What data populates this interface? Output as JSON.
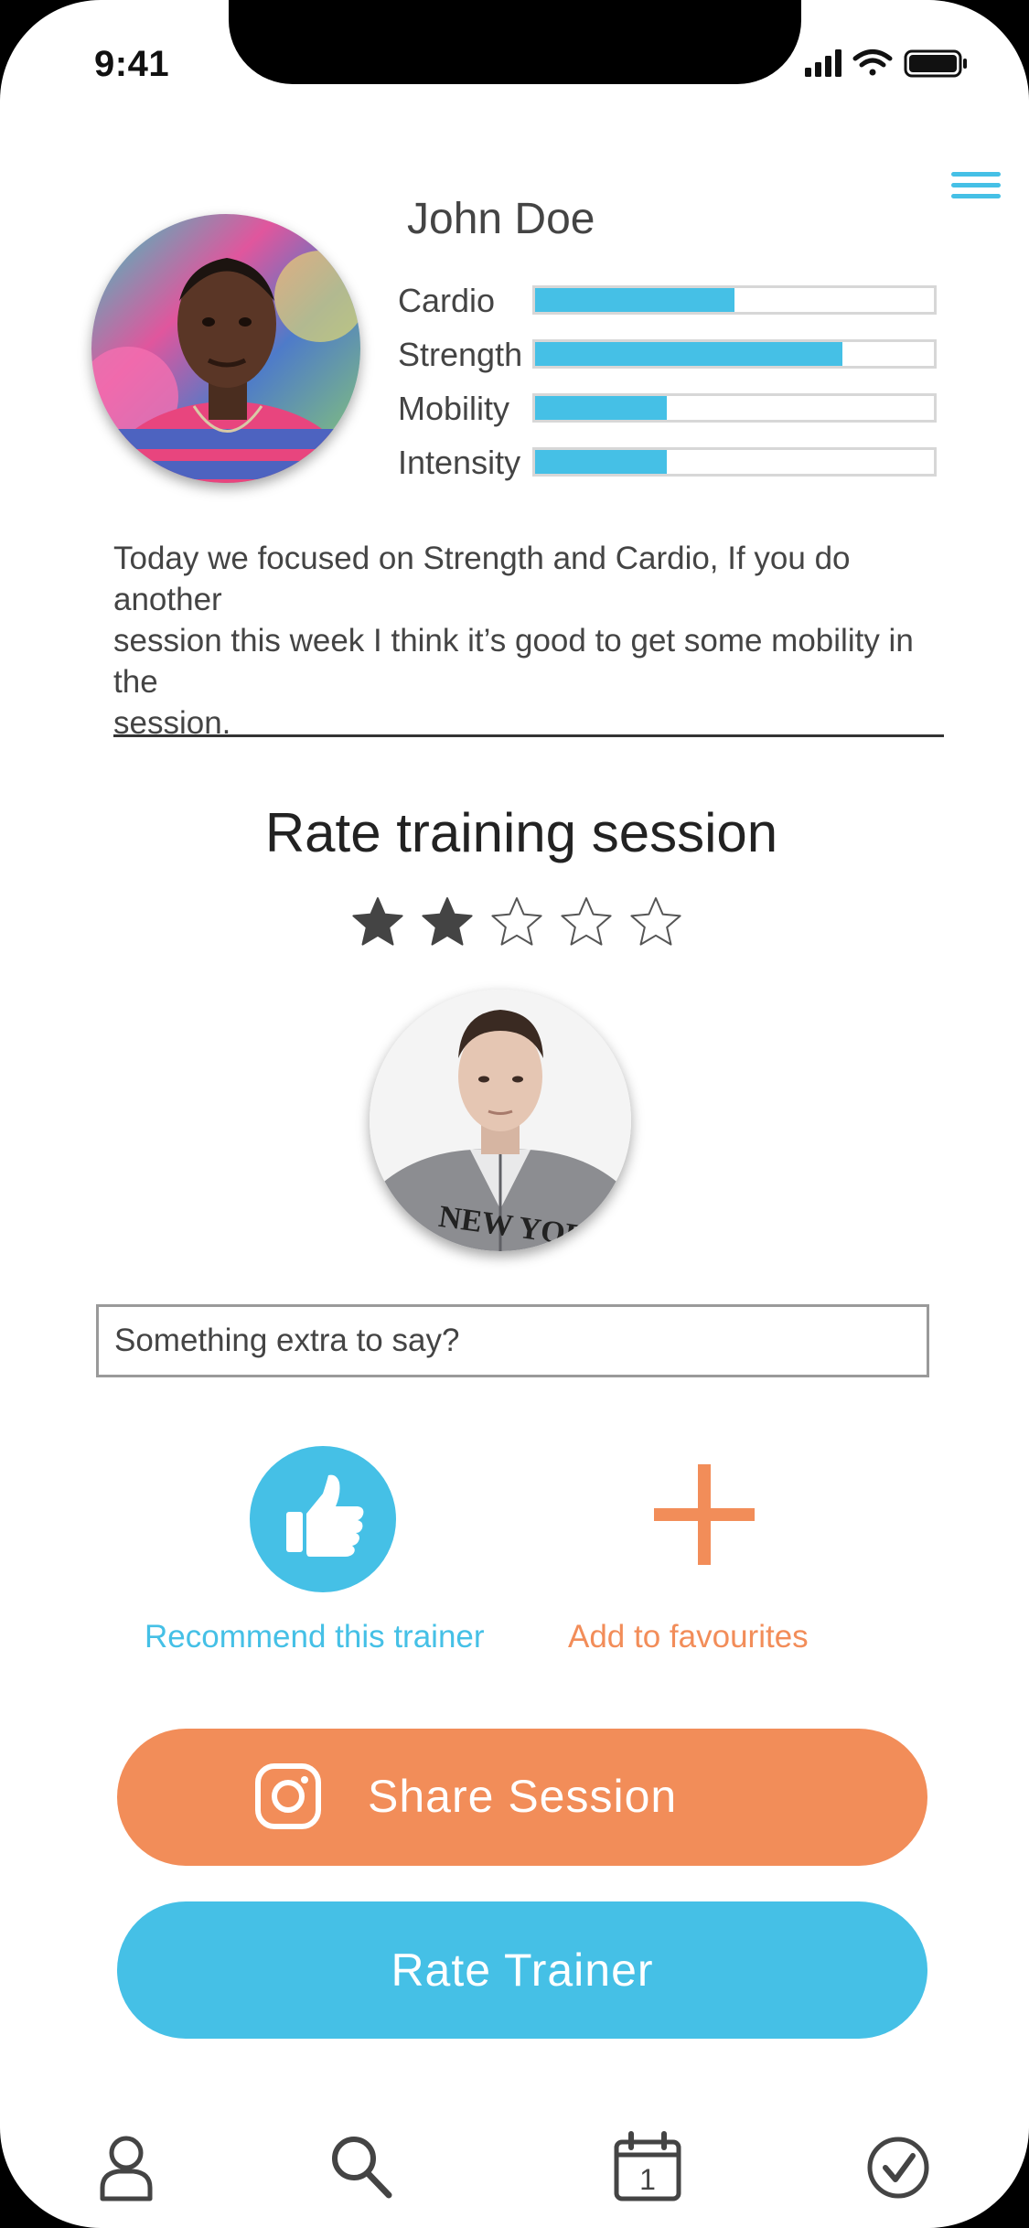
{
  "status_bar": {
    "time": "9:41",
    "icons": [
      "cellular-signal-icon",
      "wifi-icon",
      "battery-icon"
    ]
  },
  "header": {
    "menu_icon": "hamburger-menu-icon"
  },
  "profile": {
    "name": "John Doe",
    "stats": [
      {
        "label": "Cardio",
        "level": 0.5
      },
      {
        "label": "Strength",
        "level": 0.77
      },
      {
        "label": "Mobility",
        "level": 0.33
      },
      {
        "label": "Intensity",
        "level": 0.33
      }
    ]
  },
  "notes": {
    "text": "Today we focused on Strength and Cardio, If you do another\nsession this week I think it’s good to get some mobility in the\nsession."
  },
  "rating": {
    "heading": "Rate training session",
    "stars_total": 5,
    "stars_filled": 2
  },
  "comment": {
    "placeholder": "Something extra to say?"
  },
  "actions": {
    "recommend_label": "Recommend this trainer",
    "favourites_label": "Add to favourites"
  },
  "buttons": {
    "share_label": "Share Session",
    "rate_label": "Rate Trainer"
  },
  "tabbar": {
    "calendar_day": "1",
    "tabs": [
      "profile-icon",
      "search-icon",
      "calendar-icon",
      "check-circle-icon"
    ]
  },
  "colors": {
    "accent_blue": "#45c0e6",
    "accent_orange": "#f28d59",
    "star_filled": "#444444"
  }
}
